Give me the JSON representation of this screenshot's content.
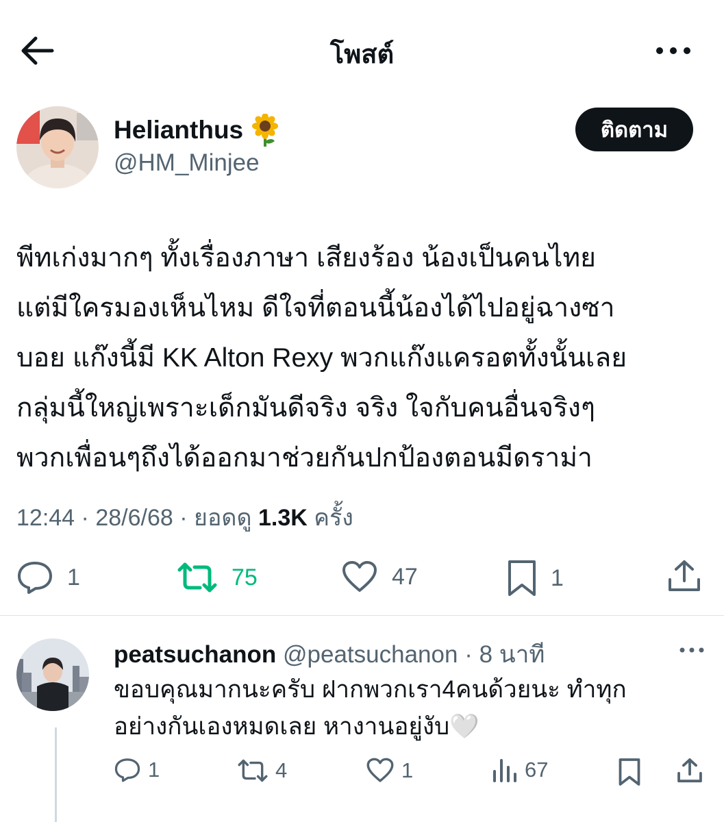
{
  "header": {
    "title": "โพสต์"
  },
  "post": {
    "display_name": "Helianthus",
    "handle": "@HM_Minjee",
    "follow_label": "ติดตาม",
    "body_lines": [
      "พีทเก่งมากๆ ทั้งเรื่องภาษา เสียงร้อง น้องเป็นคนไทย",
      "แต่มีใครมองเห็นไหม ดีใจที่ตอนนี้น้องได้ไปอยู่ฉางซา",
      "บอย แก๊งนี้มี KK Alton Rexy พวกแก๊งแครอตทั้งนั้นเลย",
      "กลุ่มนี้ใหญ่เพราะเด็กมันดีจริง จริง ใจกับคนอื่นจริงๆ",
      "พวกเพื่อนๆถึงได้ออกมาช่วยกันปกป้องตอนมีดราม่า"
    ],
    "time": "12:44",
    "date": "28/6/68",
    "views_label": "ยอดดู",
    "views": "1.3K",
    "views_suffix": "ครั้ง",
    "stats": {
      "replies": "1",
      "reposts": "75",
      "likes": "47",
      "bookmarks": "1"
    }
  },
  "reply": {
    "name": "peatsuchanon",
    "handle": "@peatsuchanon",
    "time": "8 นาที",
    "text_lines": [
      "ขอบคุณมากนะครับ ฝากพวกเรา4คนด้วยนะ ทำทุก",
      "อย่างกันเองหมดเลย หางานอยู่งับ🤍"
    ],
    "stats": {
      "replies": "1",
      "reposts": "4",
      "likes": "1",
      "views": "67"
    }
  },
  "colors": {
    "text": "#0f1419",
    "secondary": "#536471",
    "repost_active": "#00ba7c",
    "divider": "#dfe3e6"
  }
}
